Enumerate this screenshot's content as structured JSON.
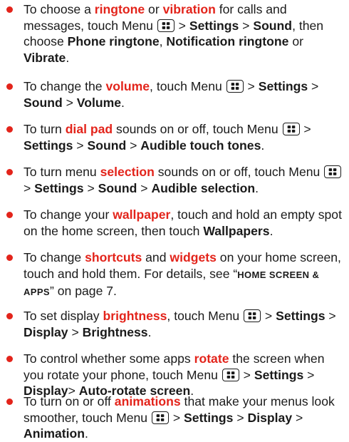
{
  "tips": [
    {
      "segments": [
        {
          "t": "To choose a ",
          "s": "n"
        },
        {
          "t": "ringtone",
          "s": "h"
        },
        {
          "t": " or ",
          "s": "n"
        },
        {
          "t": "vibration",
          "s": "h"
        },
        {
          "t": " for calls and messages, touch Menu ",
          "s": "n"
        },
        {
          "t": "",
          "s": "icon"
        },
        {
          "t": " > ",
          "s": "n"
        },
        {
          "t": "Settings",
          "s": "b"
        },
        {
          "t": " > ",
          "s": "n"
        },
        {
          "t": "Sound",
          "s": "b"
        },
        {
          "t": ", then choose ",
          "s": "n"
        },
        {
          "t": "Phone ringtone",
          "s": "b"
        },
        {
          "t": ", ",
          "s": "n"
        },
        {
          "t": "Notification ringtone",
          "s": "b"
        },
        {
          "t": " or ",
          "s": "n"
        },
        {
          "t": "Vibrate",
          "s": "b"
        },
        {
          "t": ".",
          "s": "n"
        }
      ]
    },
    {
      "segments": [
        {
          "t": "To change the ",
          "s": "n"
        },
        {
          "t": "volume",
          "s": "h"
        },
        {
          "t": ", touch Menu ",
          "s": "n"
        },
        {
          "t": "",
          "s": "icon"
        },
        {
          "t": " > ",
          "s": "n"
        },
        {
          "t": "Settings",
          "s": "b"
        },
        {
          "t": " > ",
          "s": "n"
        },
        {
          "t": "Sound",
          "s": "b"
        },
        {
          "t": " > ",
          "s": "n"
        },
        {
          "t": "Volume",
          "s": "b"
        },
        {
          "t": ".",
          "s": "n"
        }
      ]
    },
    {
      "segments": [
        {
          "t": "To turn ",
          "s": "n"
        },
        {
          "t": "dial pad",
          "s": "h"
        },
        {
          "t": " sounds on or off, touch Menu ",
          "s": "n"
        },
        {
          "t": "",
          "s": "icon"
        },
        {
          "t": " > ",
          "s": "n"
        },
        {
          "t": "Settings",
          "s": "b"
        },
        {
          "t": " > ",
          "s": "n"
        },
        {
          "t": "Sound",
          "s": "b"
        },
        {
          "t": " > ",
          "s": "n"
        },
        {
          "t": "Audible touch tones",
          "s": "b"
        },
        {
          "t": ".",
          "s": "n"
        }
      ]
    },
    {
      "segments": [
        {
          "t": "To turn menu ",
          "s": "n"
        },
        {
          "t": "selection",
          "s": "h"
        },
        {
          "t": " sounds on or off, touch Menu ",
          "s": "n"
        },
        {
          "t": "",
          "s": "icon"
        },
        {
          "t": " > ",
          "s": "n"
        },
        {
          "t": "Settings",
          "s": "b"
        },
        {
          "t": " > ",
          "s": "n"
        },
        {
          "t": "Sound",
          "s": "b"
        },
        {
          "t": " > ",
          "s": "n"
        },
        {
          "t": "Audible selection",
          "s": "b"
        },
        {
          "t": ".",
          "s": "n"
        }
      ]
    },
    {
      "segments": [
        {
          "t": "To change your ",
          "s": "n"
        },
        {
          "t": "wallpaper",
          "s": "h"
        },
        {
          "t": ", touch and hold an empty spot on the home screen, then touch ",
          "s": "n"
        },
        {
          "t": "Wallpapers",
          "s": "b"
        },
        {
          "t": ".",
          "s": "n"
        }
      ]
    },
    {
      "segments": [
        {
          "t": "To change ",
          "s": "n"
        },
        {
          "t": "shortcuts",
          "s": "h"
        },
        {
          "t": " and ",
          "s": "n"
        },
        {
          "t": "widgets",
          "s": "h"
        },
        {
          "t": " on your home screen, touch and hold them. For details, see “",
          "s": "n"
        },
        {
          "t": "HOME SCREEN & APPS",
          "s": "sc"
        },
        {
          "t": "” on page 7.",
          "s": "n"
        }
      ]
    },
    {
      "segments": [
        {
          "t": "To set display ",
          "s": "n"
        },
        {
          "t": "brightness",
          "s": "h"
        },
        {
          "t": ", touch Menu ",
          "s": "n"
        },
        {
          "t": "",
          "s": "icon"
        },
        {
          "t": " > ",
          "s": "n"
        },
        {
          "t": "Settings",
          "s": "b"
        },
        {
          "t": " > ",
          "s": "n"
        },
        {
          "t": "Display",
          "s": "b"
        },
        {
          "t": " > ",
          "s": "n"
        },
        {
          "t": "Brightness",
          "s": "b"
        },
        {
          "t": ".",
          "s": "n"
        }
      ]
    },
    {
      "segments": [
        {
          "t": "To control whether some apps ",
          "s": "n"
        },
        {
          "t": "rotate",
          "s": "h"
        },
        {
          "t": " the screen when you rotate your phone, touch Menu ",
          "s": "n"
        },
        {
          "t": "",
          "s": "icon"
        },
        {
          "t": " > ",
          "s": "n"
        },
        {
          "t": "Settings",
          "s": "b"
        },
        {
          "t": " > ",
          "s": "n"
        },
        {
          "t": "Display",
          "s": "b"
        },
        {
          "t": ">  ",
          "s": "n"
        },
        {
          "t": "Auto-rotate screen",
          "s": "b"
        },
        {
          "t": ".",
          "s": "n"
        }
      ]
    },
    {
      "segments": [
        {
          "t": "To turn on or off ",
          "s": "n"
        },
        {
          "t": "animations",
          "s": "h"
        },
        {
          "t": " that make your menus look smoother, touch Menu ",
          "s": "n"
        },
        {
          "t": "",
          "s": "icon"
        },
        {
          "t": " > ",
          "s": "n"
        },
        {
          "t": "Settings",
          "s": "b"
        },
        {
          "t": " > ",
          "s": "n"
        },
        {
          "t": "Display",
          "s": "b"
        },
        {
          "t": " > ",
          "s": "n"
        },
        {
          "t": "Animation",
          "s": "b"
        },
        {
          "t": ".",
          "s": "n"
        }
      ]
    }
  ],
  "icons": {
    "menu": "menu-grid-icon"
  },
  "colors": {
    "accent": "#e3241b",
    "text": "#1a1a1a"
  }
}
